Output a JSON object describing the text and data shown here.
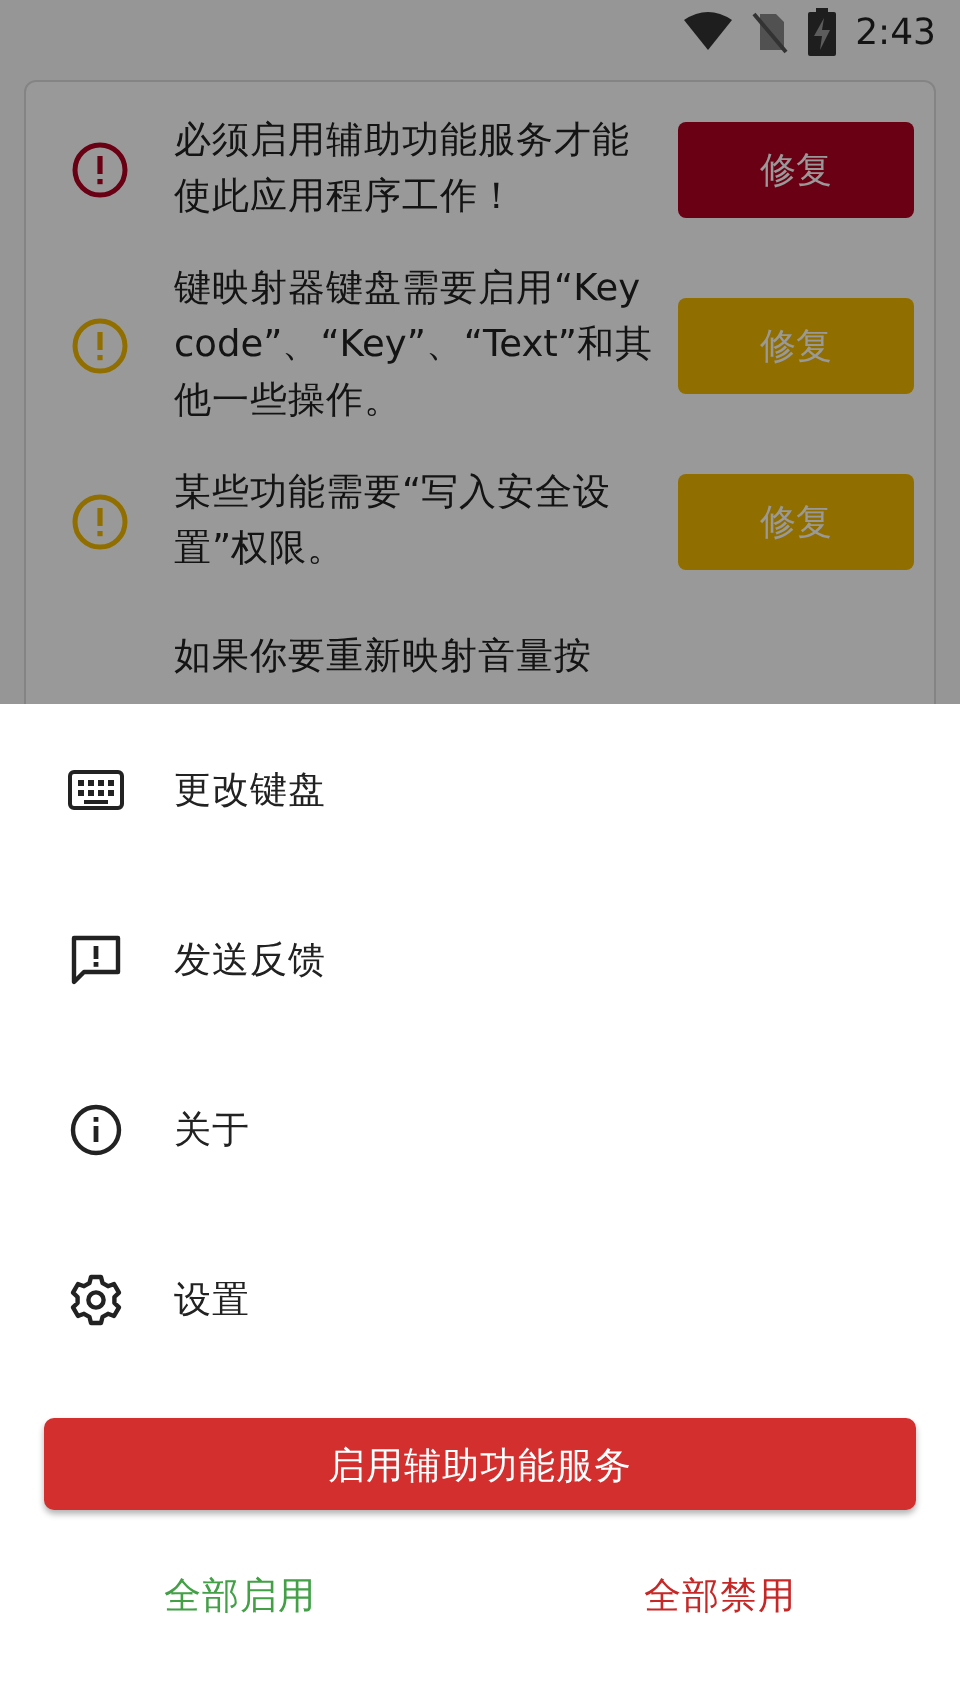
{
  "status_bar": {
    "time": "2:43"
  },
  "warnings": [
    {
      "kind": "error",
      "lines": [
        "必须启用辅助功能服务才能",
        "使此应用程序工作！"
      ],
      "button": "修复"
    },
    {
      "kind": "warning",
      "lines": [
        "键映射器键盘需要启用“Key",
        "code”、“Key”、“Text”和其",
        "他一些操作。"
      ],
      "button": "修复"
    },
    {
      "kind": "warning",
      "lines": [
        "某些功能需要“写入安全设",
        "置”权限。"
      ],
      "button": "修复"
    },
    {
      "kind": "partial",
      "lines": [
        "如果你要重新映射音量按"
      ]
    }
  ],
  "menu": [
    {
      "kind": "keyboard",
      "label": "更改键盘"
    },
    {
      "kind": "feedback",
      "label": "发送反馈"
    },
    {
      "kind": "info",
      "label": "关于"
    },
    {
      "kind": "settings",
      "label": "设置"
    }
  ],
  "primary_button": "启用辅助功能服务",
  "enable_all": "全部启用",
  "disable_all": "全部禁用"
}
